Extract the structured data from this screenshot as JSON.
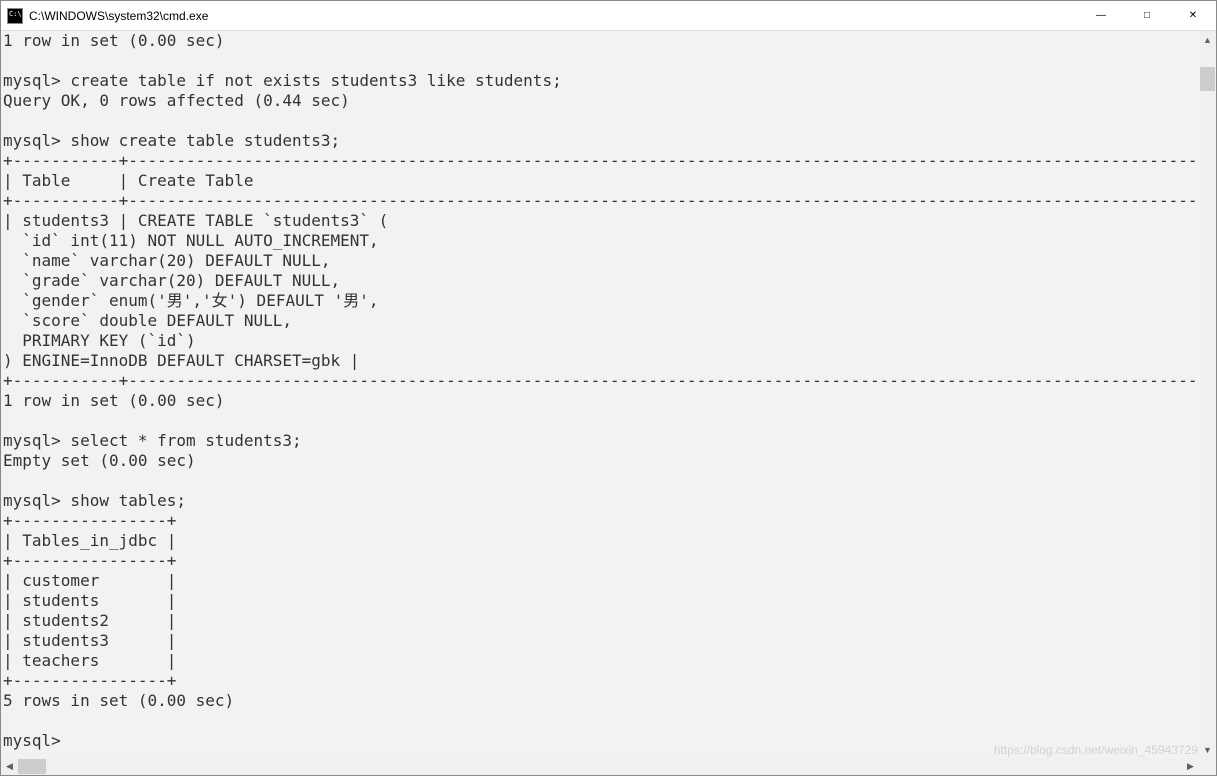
{
  "window": {
    "title": "C:\\WINDOWS\\system32\\cmd.exe"
  },
  "terminal": {
    "content": "1 row in set (0.00 sec)\n\nmysql> create table if not exists students3 like students;\nQuery OK, 0 rows affected (0.44 sec)\n\nmysql> show create table students3;\n+-----------+-----------------------------------------------------------------------------------------------------------------------------------\n| Table     | Create Table\n+-----------+-----------------------------------------------------------------------------------------------------------------------------------\n| students3 | CREATE TABLE `students3` (\n  `id` int(11) NOT NULL AUTO_INCREMENT,\n  `name` varchar(20) DEFAULT NULL,\n  `grade` varchar(20) DEFAULT NULL,\n  `gender` enum('男','女') DEFAULT '男',\n  `score` double DEFAULT NULL,\n  PRIMARY KEY (`id`)\n) ENGINE=InnoDB DEFAULT CHARSET=gbk |\n+-----------+-----------------------------------------------------------------------------------------------------------------------------------\n1 row in set (0.00 sec)\n\nmysql> select * from students3;\nEmpty set (0.00 sec)\n\nmysql> show tables;\n+----------------+\n| Tables_in_jdbc |\n+----------------+\n| customer       |\n| students       |\n| students2      |\n| students3      |\n| teachers       |\n+----------------+\n5 rows in set (0.00 sec)\n\nmysql>"
  },
  "watermark": "https://blog.csdn.net/weixin_45943729"
}
